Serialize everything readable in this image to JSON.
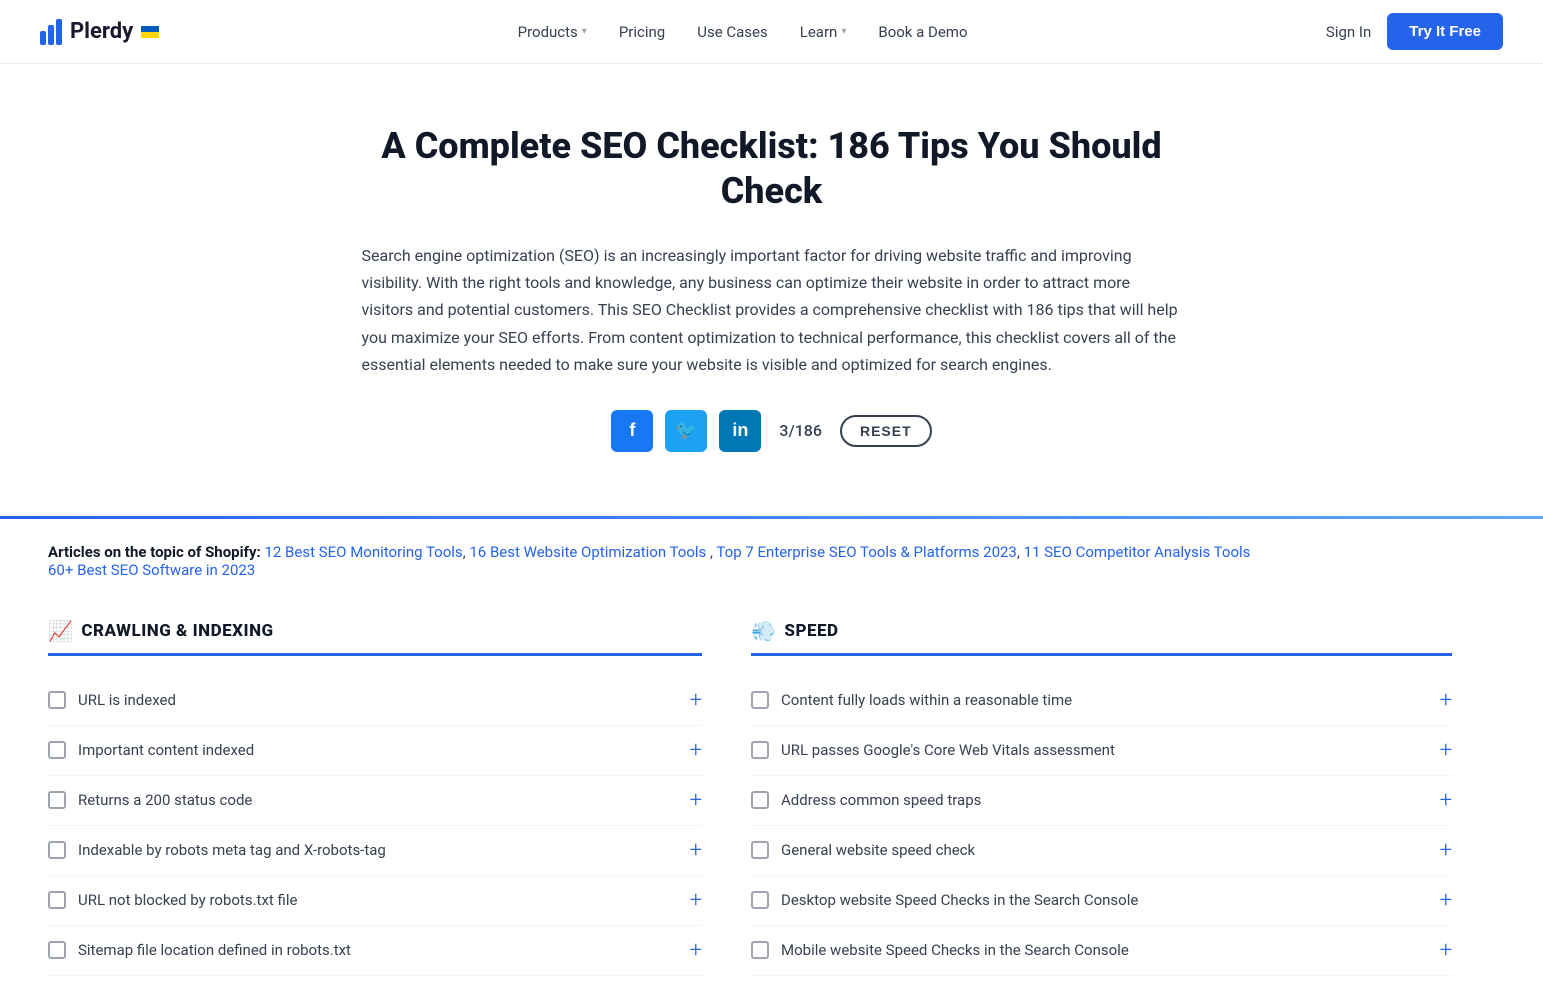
{
  "nav": {
    "logo_text": "Plerdy",
    "items": [
      {
        "label": "Products",
        "has_dropdown": true
      },
      {
        "label": "Pricing",
        "has_dropdown": false
      },
      {
        "label": "Use Cases",
        "has_dropdown": false
      },
      {
        "label": "Learn",
        "has_dropdown": true
      },
      {
        "label": "Book a Demo",
        "has_dropdown": false
      }
    ],
    "sign_in": "Sign In",
    "try_free": "Try It Free"
  },
  "hero": {
    "title": "A Complete SEO Checklist: 186 Tips You Should Check",
    "description": "Search engine optimization (SEO) is an increasingly important factor for driving website traffic and improving visibility. With the right tools and knowledge, any business can optimize their website in order to attract more visitors and potential customers. This SEO Checklist provides a comprehensive checklist with 186 tips that will help you maximize your SEO efforts. From content optimization to technical performance, this checklist covers all of the essential elements needed to make sure your website is visible and optimized for search engines.",
    "counter_current": "3",
    "counter_total": "186",
    "reset_label": "RESET"
  },
  "articles": {
    "prefix": "Articles on the topic of Shopify:",
    "links": [
      "12 Best SEO Monitoring Tools",
      "16 Best Website Optimization Tools",
      "Top 7 Enterprise SEO Tools & Platforms 2023",
      "11 SEO Competitor Analysis Tools",
      "60+ Best SEO Software in 2023"
    ]
  },
  "crawling_section": {
    "title": "CRAWLING & INDEXING",
    "emoji": "📈",
    "items": [
      "URL is indexed",
      "Important content indexed",
      "Returns a 200 status code",
      "Indexable by robots meta tag and X-robots-tag",
      "URL not blocked by robots.txt file",
      "Sitemap file location defined in robots.txt"
    ]
  },
  "speed_section": {
    "title": "SPEED",
    "emoji": "💨",
    "items": [
      "Content fully loads within a reasonable time",
      "URL passes Google's Core Web Vitals assessment",
      "Address common speed traps",
      "General website speed check",
      "Desktop website Speed Checks in the Search Console",
      "Mobile website Speed Checks in the Search Console"
    ]
  }
}
